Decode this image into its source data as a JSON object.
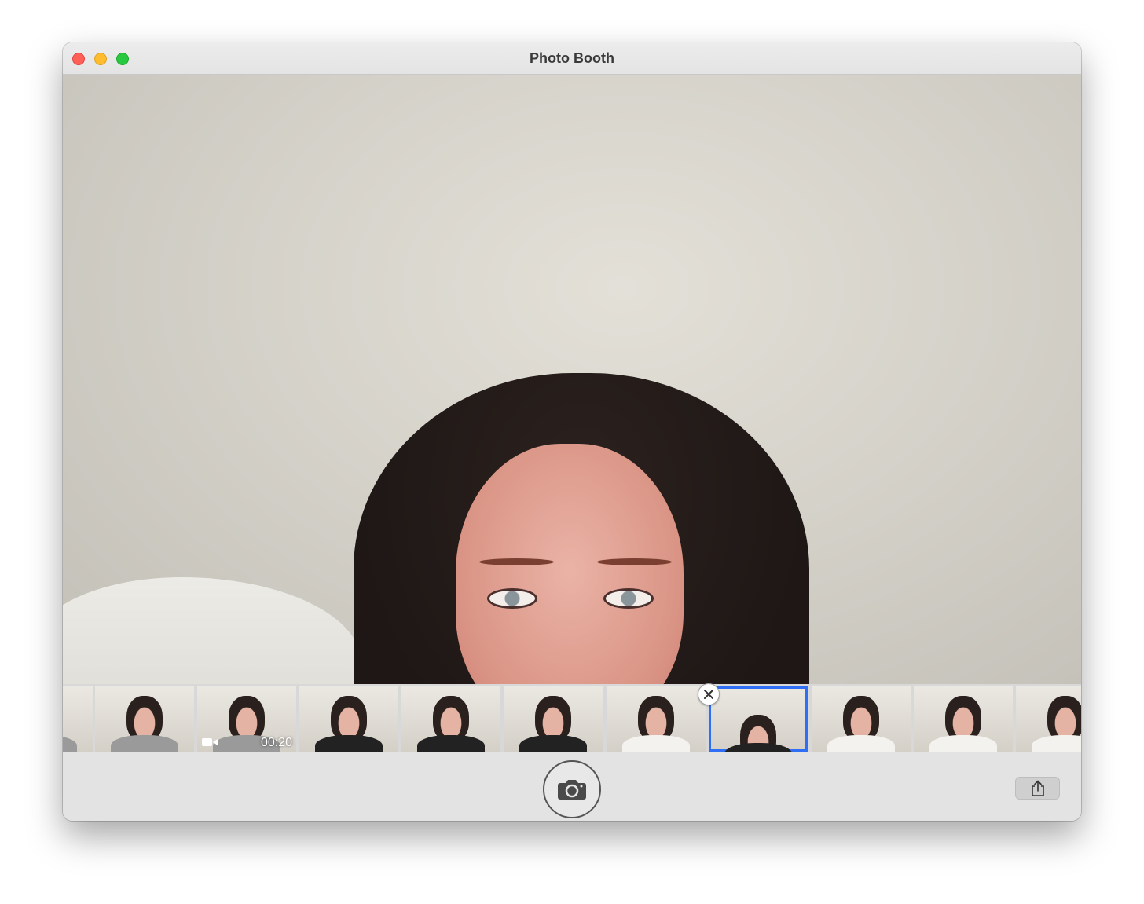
{
  "window": {
    "title": "Photo Booth"
  },
  "controls": [
    "close",
    "minimize",
    "maximize"
  ],
  "viewer": {
    "description_icon": "live-camera-preview"
  },
  "thumbnails": [
    {
      "id": 0,
      "type": "photo",
      "selected": false
    },
    {
      "id": 1,
      "type": "photo",
      "selected": false
    },
    {
      "id": 2,
      "type": "video",
      "duration": "00:20",
      "selected": false
    },
    {
      "id": 3,
      "type": "photo",
      "selected": false
    },
    {
      "id": 4,
      "type": "photo",
      "selected": false
    },
    {
      "id": 5,
      "type": "photo",
      "selected": false
    },
    {
      "id": 6,
      "type": "photo",
      "selected": false
    },
    {
      "id": 7,
      "type": "photo",
      "selected": true
    },
    {
      "id": 8,
      "type": "photo",
      "selected": false
    },
    {
      "id": 9,
      "type": "photo",
      "selected": false
    },
    {
      "id": 10,
      "type": "photo",
      "selected": false
    }
  ],
  "toolbar": {
    "shutter_icon": "camera-icon",
    "share_icon": "share-icon"
  },
  "colors": {
    "selection": "#2f6ff5",
    "close": "#fe5f57",
    "minimize": "#febc2e",
    "maximize": "#28c840"
  }
}
